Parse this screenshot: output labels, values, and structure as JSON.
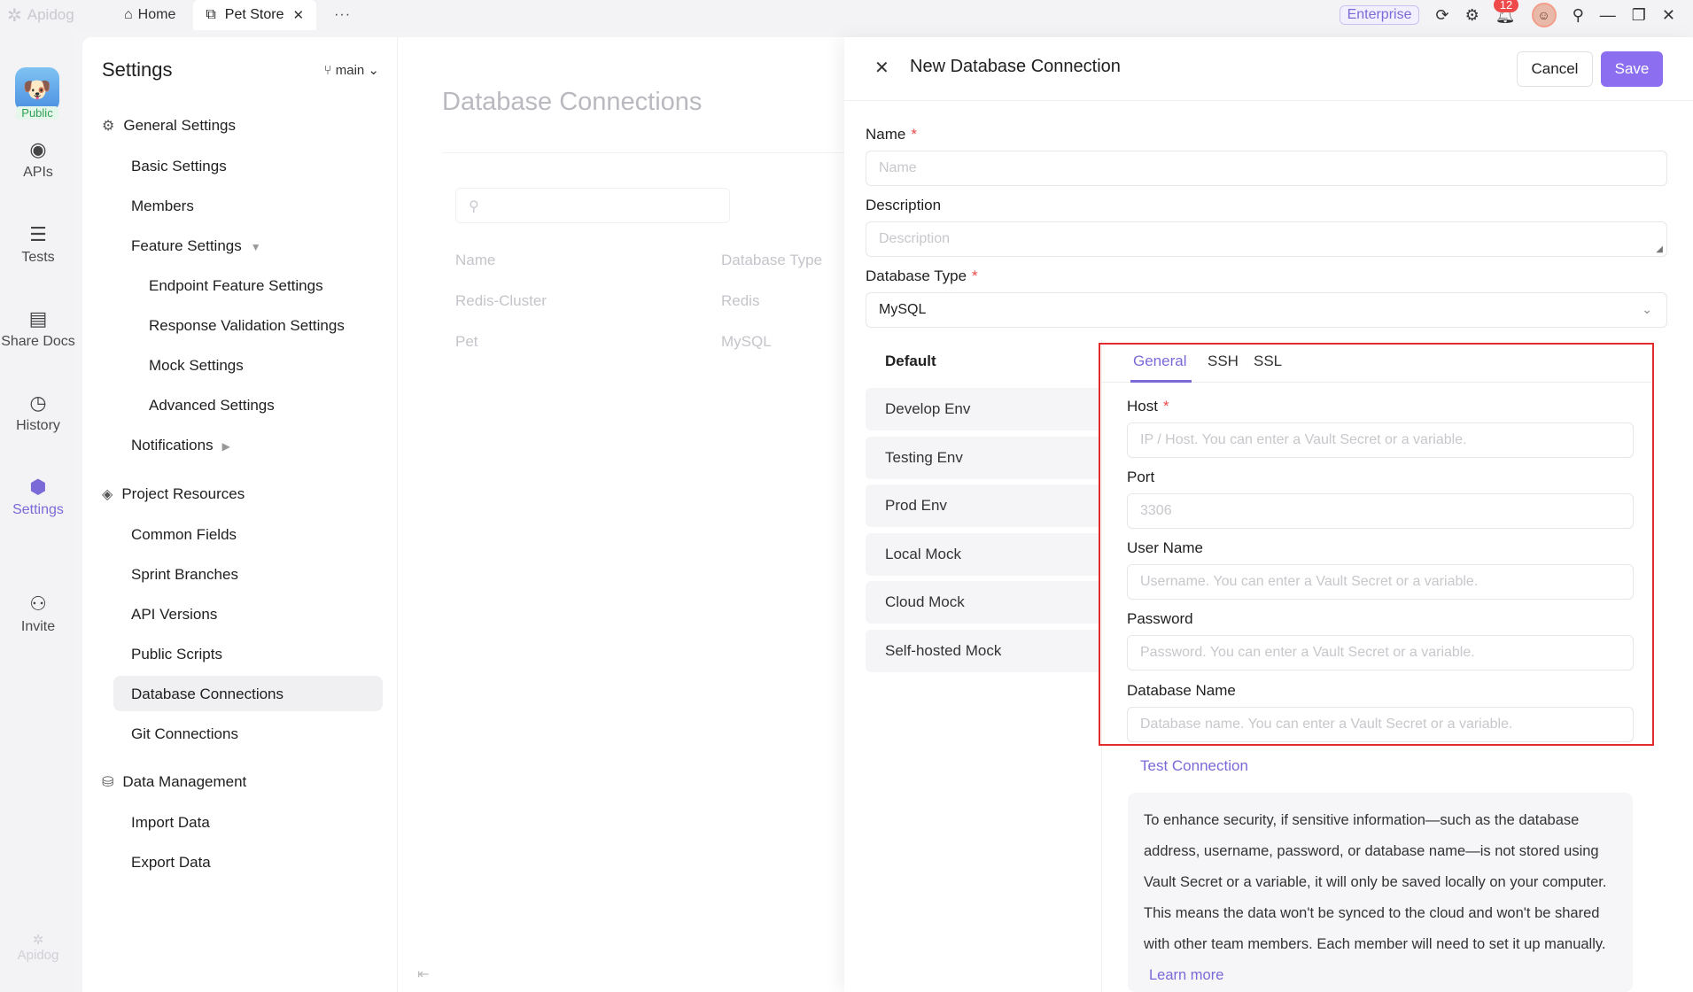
{
  "titlebar": {
    "app_name": "Apidog",
    "home_tab": "Home",
    "active_tab": "Pet Store",
    "more": "···",
    "plan_badge": "Enterprise",
    "notification_count": "12"
  },
  "rail": {
    "logo_badge": "Public",
    "items": [
      {
        "label": "APIs",
        "icon": "api-icon"
      },
      {
        "label": "Tests",
        "icon": "tests-icon"
      },
      {
        "label": "Share Docs",
        "icon": "book-icon"
      },
      {
        "label": "History",
        "icon": "clock-icon"
      },
      {
        "label": "Settings",
        "icon": "settings-icon"
      },
      {
        "label": "Invite",
        "icon": "add-user-icon"
      }
    ],
    "footer": "Apidog"
  },
  "settings": {
    "title": "Settings",
    "branch": "main",
    "sections": [
      {
        "label": "General Settings",
        "items": [
          "Basic Settings",
          "Members",
          "Feature Settings",
          "Endpoint Feature Settings",
          "Response Validation Settings",
          "Mock Settings",
          "Advanced Settings",
          "Notifications"
        ]
      },
      {
        "label": "Project Resources",
        "items": [
          "Common Fields",
          "Sprint Branches",
          "API Versions",
          "Public Scripts",
          "Database Connections",
          "Git Connections"
        ]
      },
      {
        "label": "Data Management",
        "items": [
          "Import Data",
          "Export Data"
        ]
      }
    ],
    "selected": "Database Connections"
  },
  "main": {
    "title": "Database Connections",
    "columns": [
      "Name",
      "Database Type"
    ],
    "rows": [
      [
        "Redis-Cluster",
        "Redis"
      ],
      [
        "Pet",
        "MySQL"
      ]
    ]
  },
  "drawer": {
    "title": "New Database Connection",
    "cancel": "Cancel",
    "save": "Save",
    "name_label": "Name",
    "name_placeholder": "Name",
    "description_label": "Description",
    "description_placeholder": "Description",
    "db_type_label": "Database Type",
    "db_type_value": "MySQL",
    "required_mark": "*",
    "environments": [
      "Default",
      "Develop Env",
      "Testing Env",
      "Prod Env",
      "Local Mock",
      "Cloud Mock",
      "Self-hosted Mock"
    ],
    "tabs": [
      "General",
      "SSH",
      "SSL"
    ],
    "fields": [
      {
        "label": "Host",
        "placeholder": "IP / Host. You can enter a Vault Secret or a variable.",
        "required": true
      },
      {
        "label": "Port",
        "placeholder": "3306",
        "required": false
      },
      {
        "label": "User Name",
        "placeholder": "Username. You can enter a Vault Secret or a variable.",
        "required": false
      },
      {
        "label": "Password",
        "placeholder": "Password. You can enter a Vault Secret or a variable.",
        "required": false
      },
      {
        "label": "Database Name",
        "placeholder": "Database name. You can enter a Vault Secret or a variable.",
        "required": false
      }
    ],
    "test_connection": "Test Connection",
    "info_text": "To enhance security, if sensitive information—such as the database address, username, password, or database name—is not stored using Vault Secret or a variable, it will only be saved locally on your computer. This means the data won't be synced to the cloud and won't be shared with other team members. Each member will need to set it up manually.",
    "learn_more": "Learn more"
  },
  "colors": {
    "accent": "#8b6ff0",
    "highlight_border": "#e32b2b",
    "required": "#e94848"
  }
}
